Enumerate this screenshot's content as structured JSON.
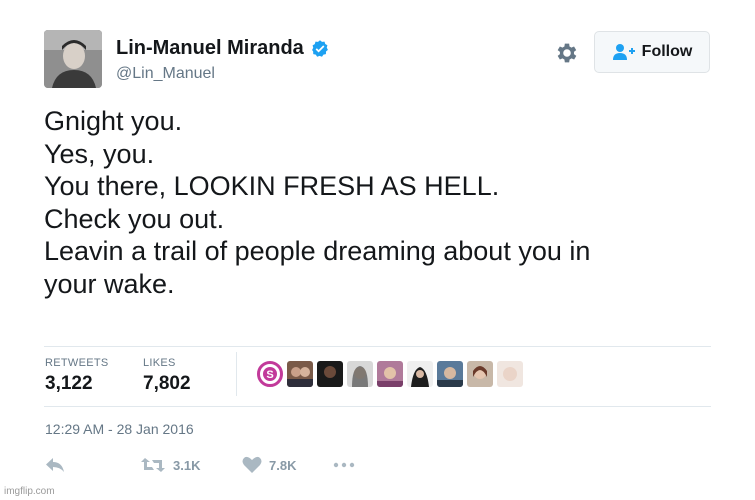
{
  "user": {
    "name": "Lin-Manuel Miranda",
    "handle": "@Lin_Manuel"
  },
  "header": {
    "follow_label": "Follow",
    "gear_icon": "gear-icon",
    "follow_icon": "add-user-icon"
  },
  "tweet": {
    "lines": [
      "Gnight you.",
      "Yes, you.",
      "You there, LOOKIN FRESH AS HELL.",
      "Check you out.",
      "Leavin a trail of people dreaming about you in",
      "your wake."
    ]
  },
  "stats": {
    "retweets_label": "RETWEETS",
    "retweets_value": "3,122",
    "likes_label": "LIKES",
    "likes_value": "7,802"
  },
  "timestamp": "12:29 AM - 28 Jan 2016",
  "actions": {
    "retweet_count": "3.1K",
    "like_count": "7.8K"
  },
  "watermark": "imgflip.com",
  "colors": {
    "verified": "#1da1f2",
    "follow_icon": "#1da1f2",
    "secondary_text": "#657786",
    "action_gray": "#aab8c2",
    "liker_ring": "#c23a9a"
  }
}
